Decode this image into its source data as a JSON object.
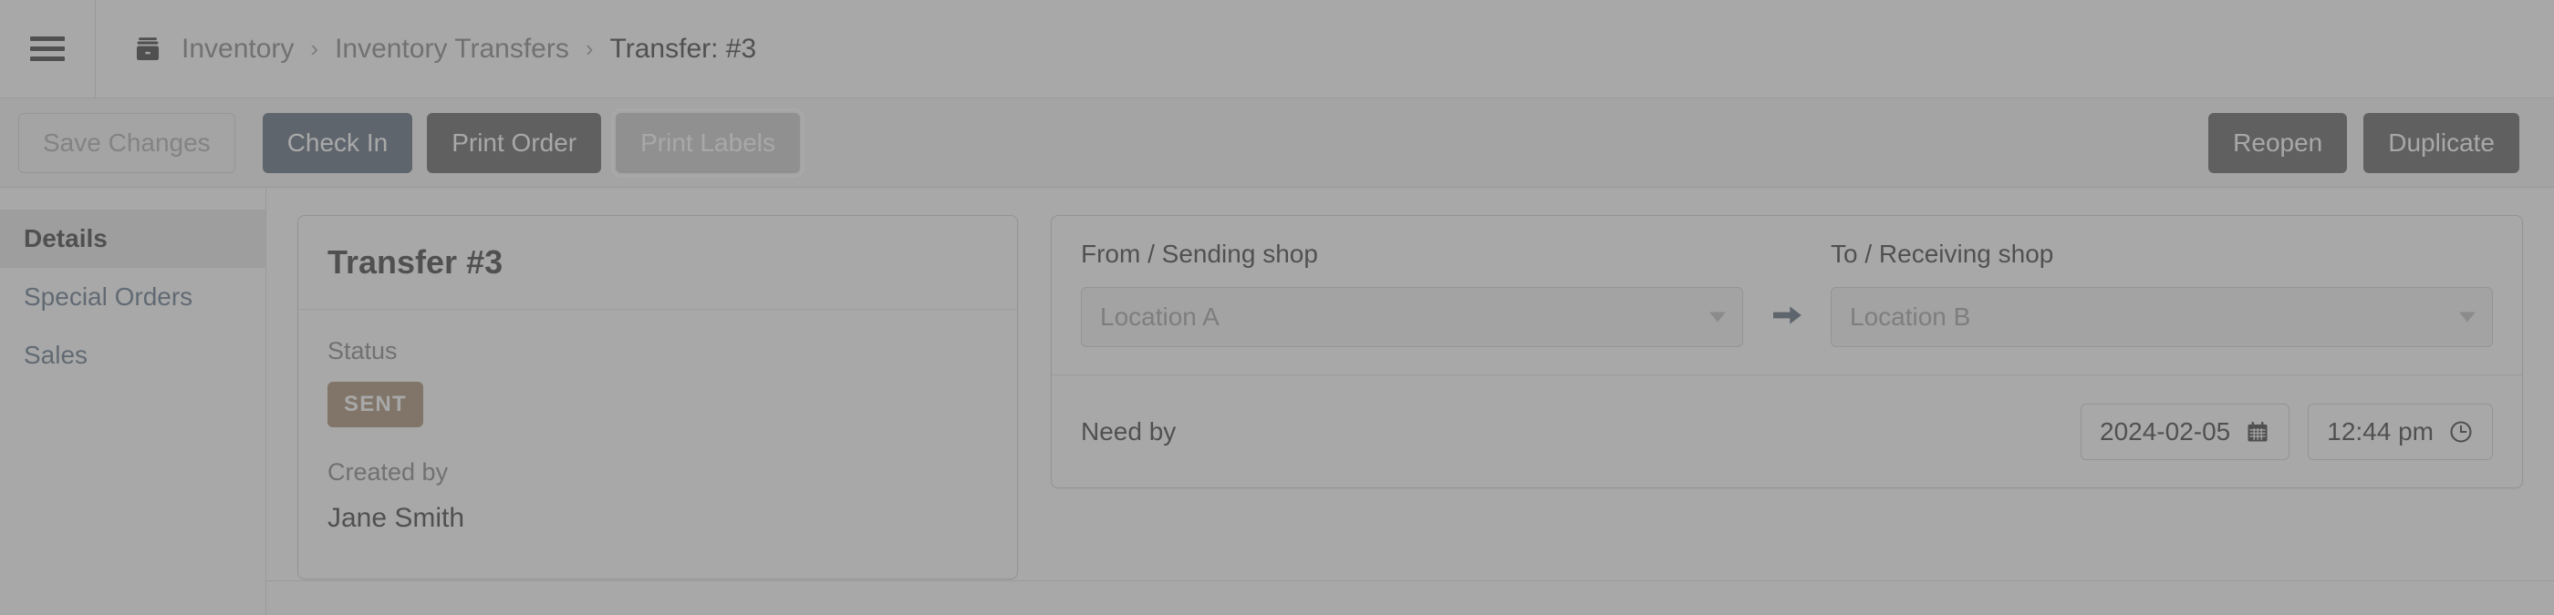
{
  "header": {
    "menu_icon": "hamburger-menu-icon",
    "breadcrumb_icon": "inventory-box-icon",
    "breadcrumb": [
      {
        "label": "Inventory",
        "current": false
      },
      {
        "label": "Inventory Transfers",
        "current": false
      },
      {
        "label": "Transfer: #3",
        "current": true
      }
    ],
    "separator": "›"
  },
  "toolbar": {
    "save_label": "Save Changes",
    "check_in_label": "Check In",
    "print_order_label": "Print Order",
    "print_labels_label": "Print Labels",
    "reopen_label": "Reopen",
    "duplicate_label": "Duplicate"
  },
  "sidebar": {
    "items": [
      {
        "label": "Details",
        "active": true
      },
      {
        "label": "Special Orders",
        "active": false
      },
      {
        "label": "Sales",
        "active": false
      }
    ]
  },
  "card": {
    "title": "Transfer #3",
    "status_label": "Status",
    "status_value": "SENT",
    "created_by_label": "Created by",
    "created_by_value": "Jane Smith"
  },
  "panel": {
    "from_label": "From / Sending shop",
    "from_value": "Location A",
    "to_label": "To / Receiving shop",
    "to_value": "Location B",
    "transfer_arrow_icon": "arrow-right-icon",
    "need_by_label": "Need by",
    "need_by_date": "2024-02-05",
    "need_by_time": "12:44 pm",
    "calendar_icon": "calendar-icon",
    "clock_icon": "clock-icon"
  },
  "colors": {
    "primary_button": "#1c4e80",
    "dark_button": "#3b3b3b",
    "status_badge": "#c06c14",
    "link": "#1c5d99",
    "arrow": "#1c4e80"
  }
}
